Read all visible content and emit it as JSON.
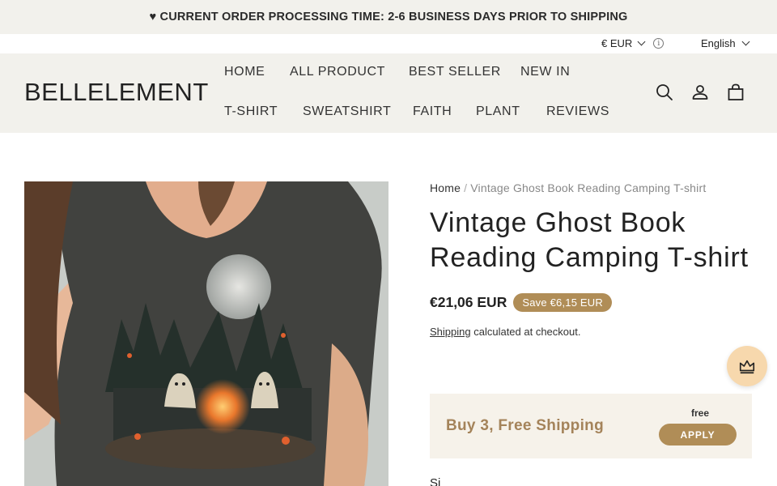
{
  "announcement": "♥ CURRENT ORDER PROCESSING TIME: 2-6 BUSINESS DAYS PRIOR TO SHIPPING",
  "utility": {
    "currency": "€ EUR",
    "language": "English"
  },
  "header": {
    "logo": "BELLELEMENT",
    "nav": [
      "HOME",
      "ALL PRODUCT",
      "BEST SELLER",
      "NEW IN",
      "T-SHIRT",
      "SWEATSHIRT",
      "FAITH",
      "PLANT",
      "REVIEWS"
    ],
    "icons": [
      "search-icon",
      "account-icon",
      "cart-icon"
    ]
  },
  "breadcrumb": {
    "home": "Home",
    "separator": "/",
    "current": "Vintage Ghost Book Reading Camping T-shirt"
  },
  "product": {
    "title": "Vintage Ghost Book Reading Camping T-shirt",
    "price": "€21,06 EUR",
    "save_badge": "Save €6,15 EUR",
    "shipping_link": "Shipping",
    "shipping_note": " calculated at checkout."
  },
  "promo": {
    "text": "Buy 3, Free Shipping",
    "free_label": "free",
    "apply_label": "APPLY"
  },
  "size_label": "Si",
  "colors": {
    "accent": "#b08d57",
    "header_bg": "#f2f1ec",
    "promo_text": "#a4835a",
    "reward_bg": "#f7d8ad"
  }
}
